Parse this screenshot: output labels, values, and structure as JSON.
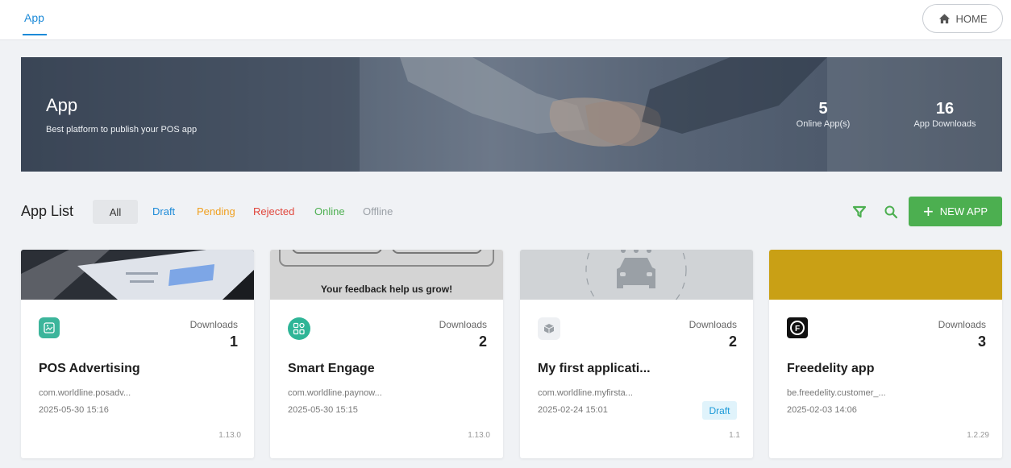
{
  "topbar": {
    "tab_label": "App",
    "home_label": "HOME"
  },
  "banner": {
    "title": "App",
    "subtitle": "Best platform to publish your POS app",
    "online_count": "5",
    "online_label": "Online App(s)",
    "downloads_count": "16",
    "downloads_label": "App Downloads"
  },
  "app_list": {
    "title": "App List",
    "filters": {
      "all": "All",
      "draft": "Draft",
      "pending": "Pending",
      "rejected": "Rejected",
      "online": "Online",
      "offline": "Offline"
    },
    "new_app_label": "NEW APP"
  },
  "cards": [
    {
      "name": "POS Advertising",
      "package": "com.worldline.posadv...",
      "date": "2025-05-30 15:16",
      "downloads_label": "Downloads",
      "downloads": "1",
      "version": "1.13.0",
      "icon": "gallery-icon"
    },
    {
      "name": "Smart Engage",
      "package": "com.worldline.paynow...",
      "date": "2025-05-30 15:15",
      "downloads_label": "Downloads",
      "downloads": "2",
      "version": "1.13.0",
      "cover_text": "Your feedback help us grow!",
      "icon": "apps-grid-icon"
    },
    {
      "name": "My first applicati...",
      "package": "com.worldline.myfirsta...",
      "date": "2025-02-24 15:01",
      "downloads_label": "Downloads",
      "downloads": "2",
      "version": "1.1",
      "badge": "Draft",
      "icon": "cube-icon"
    },
    {
      "name": "Freedelity app",
      "package": "be.freedelity.customer_...",
      "date": "2025-02-03 14:06",
      "downloads_label": "Downloads",
      "downloads": "3",
      "version": "1.2.29",
      "icon": "freedelity-logo-icon"
    }
  ],
  "colors": {
    "accent_blue": "#1c8ad8",
    "green": "#4caf50",
    "orange": "#f0a020",
    "red": "#e0463c",
    "gold": "#c9a015"
  }
}
